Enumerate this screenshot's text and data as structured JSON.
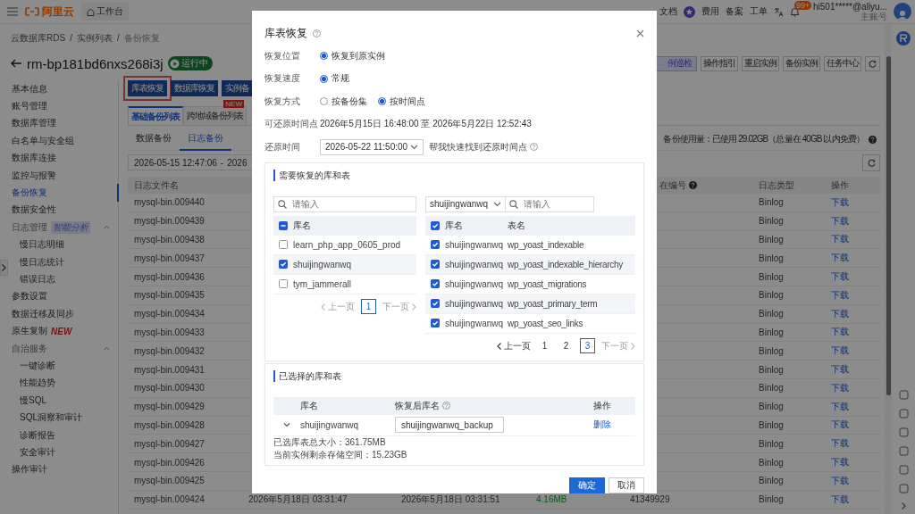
{
  "topbar": {
    "logo": "阿里云",
    "workbench": "工作台",
    "links": [
      "文档",
      "费用",
      "备案",
      "工单"
    ],
    "badge": "99+",
    "account": "hi501*****@aliyu...",
    "account_role": "主账号"
  },
  "breadcrumb": [
    "云数据库RDS",
    "/",
    "实例列表",
    "/",
    "备份恢复"
  ],
  "instance": {
    "id": "rm-bp181bd6nxs268i3j",
    "status": "运行中"
  },
  "header_buttons": [
    {
      "label": "例巡检",
      "highlighted": true
    },
    {
      "label": "操作指引",
      "highlighted": false
    },
    {
      "label": "重启实例",
      "highlighted": false
    },
    {
      "label": "备份实例",
      "highlighted": false
    },
    {
      "label": "任务中心",
      "highlighted": false
    }
  ],
  "sidebar": {
    "items": [
      {
        "label": "基本信息",
        "selected": false
      },
      {
        "label": "账号管理",
        "selected": false
      },
      {
        "label": "数据库管理",
        "selected": false
      },
      {
        "label": "白名单与安全组",
        "selected": false
      },
      {
        "label": "数据库连接",
        "selected": false
      },
      {
        "label": "监控与报警",
        "selected": false
      },
      {
        "label": "备份恢复",
        "selected": true
      },
      {
        "label": "数据安全性",
        "selected": false
      },
      {
        "label": "日志管理",
        "selected": false,
        "tag": "智能分析",
        "expanded": true,
        "children": [
          {
            "label": "慢日志明细",
            "selected": false
          },
          {
            "label": "慢日志统计",
            "selected": false
          },
          {
            "label": "错误日志",
            "selected": false
          }
        ]
      },
      {
        "label": "参数设置",
        "selected": false
      },
      {
        "label": "数据迁移及同步",
        "selected": false
      },
      {
        "label": "原生复制",
        "selected": false,
        "badge": "NEW"
      },
      {
        "label": "自治服务",
        "selected": false,
        "expanded": true,
        "children": [
          {
            "label": "一键诊断",
            "selected": false
          },
          {
            "label": "性能趋势",
            "selected": false
          },
          {
            "label": "慢SQL",
            "selected": false
          },
          {
            "label": "SQL洞察和审计",
            "selected": false
          },
          {
            "label": "诊断报告",
            "selected": false
          },
          {
            "label": "安全审计",
            "selected": false
          }
        ]
      },
      {
        "label": "操作审计",
        "selected": false
      }
    ]
  },
  "action_buttons": [
    {
      "label": "库表恢复",
      "highlighted": true
    },
    {
      "label": "数据库恢复",
      "highlighted": false
    },
    {
      "label": "实例备",
      "highlighted": false
    }
  ],
  "tabs": [
    {
      "label": "基础备份列表",
      "selected": true
    },
    {
      "label": "跨地域备份列表",
      "selected": false,
      "badge": "NEW"
    }
  ],
  "subtabs": [
    {
      "label": "数据备份",
      "selected": false
    },
    {
      "label": "日志备份",
      "selected": true
    }
  ],
  "usage": "备份使用量：已使用 29.02GB（总量在 40GB 以内免费）",
  "date_range": {
    "start": "2026-05-15 12:47:06",
    "separator": "-",
    "end": "2026"
  },
  "table": {
    "columns": [
      "日志文件名",
      "在编号",
      "日志类型",
      "操作"
    ],
    "rows": [
      {
        "file": "mysql-bin.009440",
        "type": "Binlog",
        "action": "下载"
      },
      {
        "file": "mysql-bin.009439",
        "type": "Binlog",
        "action": "下载"
      },
      {
        "file": "mysql-bin.009438",
        "type": "Binlog",
        "action": "下载"
      },
      {
        "file": "mysql-bin.009437",
        "type": "Binlog",
        "action": "下载"
      },
      {
        "file": "mysql-bin.009436",
        "type": "Binlog",
        "action": "下载"
      },
      {
        "file": "mysql-bin.009435",
        "type": "Binlog",
        "action": "下载"
      },
      {
        "file": "mysql-bin.009434",
        "type": "Binlog",
        "action": "下载"
      },
      {
        "file": "mysql-bin.009433",
        "type": "Binlog",
        "action": "下载"
      },
      {
        "file": "mysql-bin.009432",
        "type": "Binlog",
        "action": "下载"
      },
      {
        "file": "mysql-bin.009431",
        "type": "Binlog",
        "action": "下载"
      },
      {
        "file": "mysql-bin.009430",
        "type": "Binlog",
        "action": "下载"
      },
      {
        "file": "mysql-bin.009429",
        "type": "Binlog",
        "action": "下载"
      },
      {
        "file": "mysql-bin.009428",
        "type": "Binlog",
        "action": "下载"
      },
      {
        "file": "mysql-bin.009427",
        "type": "Binlog",
        "action": "下载"
      },
      {
        "file": "mysql-bin.009426",
        "type": "Binlog",
        "action": "下载"
      },
      {
        "file": "mysql-bin.009425",
        "type": "Binlog",
        "action": "下载"
      },
      {
        "file": "mysql-bin.009424",
        "start": "2026年5月18日 03:31:47",
        "end": "2026年5月18日 03:31:51",
        "size": "4.16MB",
        "number": "41349929",
        "type": "Binlog",
        "action": "下载"
      }
    ]
  },
  "dialog": {
    "title": "库表恢复",
    "fields": [
      {
        "kind": "radio",
        "label": "恢复位置",
        "options": [
          {
            "label": "恢复到原实例",
            "selected": true
          }
        ]
      },
      {
        "kind": "radio",
        "label": "恢复速度",
        "options": [
          {
            "label": "常规",
            "selected": true
          }
        ]
      },
      {
        "kind": "radio",
        "label": "恢复方式",
        "options": [
          {
            "label": "按备份集",
            "selected": false
          },
          {
            "label": "按时间点",
            "selected": true
          }
        ]
      },
      {
        "kind": "text",
        "label": "可还原时间点",
        "value": "2026年5月15日 16:48:00 至 2026年5月22日 12:52:43"
      },
      {
        "kind": "select",
        "label": "还原时间",
        "value": "2026-05-22 11:50:00",
        "hint": "帮我快速找到还原时间点"
      }
    ],
    "source": {
      "title": "需要恢复的库和表",
      "left": {
        "placeholder": "请输入",
        "header": "库名",
        "header_checked": false,
        "header_partial": true,
        "rows": [
          {
            "name": "learn_php_app_0605_prod",
            "checked": false
          },
          {
            "name": "shuijingwanwq",
            "checked": true
          },
          {
            "name": "tym_jammerall",
            "checked": false
          }
        ],
        "pager": {
          "prev": "上一页",
          "next": "下一页",
          "prev_disabled": true,
          "next_disabled": true,
          "pages": [
            {
              "label": "1",
              "selected": true
            }
          ]
        }
      },
      "right": {
        "db_select": "shuijingwanwq",
        "placeholder": "请输入",
        "columns": [
          "库名",
          "表名"
        ],
        "header_checked": true,
        "header_partial": false,
        "rows": [
          {
            "db": "shuijingwanwq",
            "table": "wp_yoast_indexable",
            "checked": true
          },
          {
            "db": "shuijingwanwq",
            "table": "wp_yoast_indexable_hierarchy",
            "checked": true
          },
          {
            "db": "shuijingwanwq",
            "table": "wp_yoast_migrations",
            "checked": true
          },
          {
            "db": "shuijingwanwq",
            "table": "wp_yoast_primary_term",
            "checked": true
          },
          {
            "db": "shuijingwanwq",
            "table": "wp_yoast_seo_links",
            "checked": true
          }
        ],
        "pager": {
          "prev": "上一页",
          "next": "下一页",
          "prev_disabled": false,
          "next_disabled": true,
          "pages": [
            {
              "label": "1",
              "selected": false
            },
            {
              "label": "2",
              "selected": false
            },
            {
              "label": "3",
              "selected": true
            }
          ]
        }
      }
    },
    "chosen": {
      "title": "已选择的库和表",
      "columns": [
        "库名",
        "恢复后库名",
        "操作"
      ],
      "rows": [
        {
          "db": "shuijingwanwq",
          "target": "shuijingwanwq_backup",
          "action": "删除",
          "expanded": false
        }
      ],
      "size": "已选库表总大小：361.75MB",
      "free": "当前实例剩余存储空间：15.23GB"
    },
    "buttons": [
      {
        "label": "确定",
        "primary": true
      },
      {
        "label": "取消",
        "primary": false
      }
    ]
  }
}
